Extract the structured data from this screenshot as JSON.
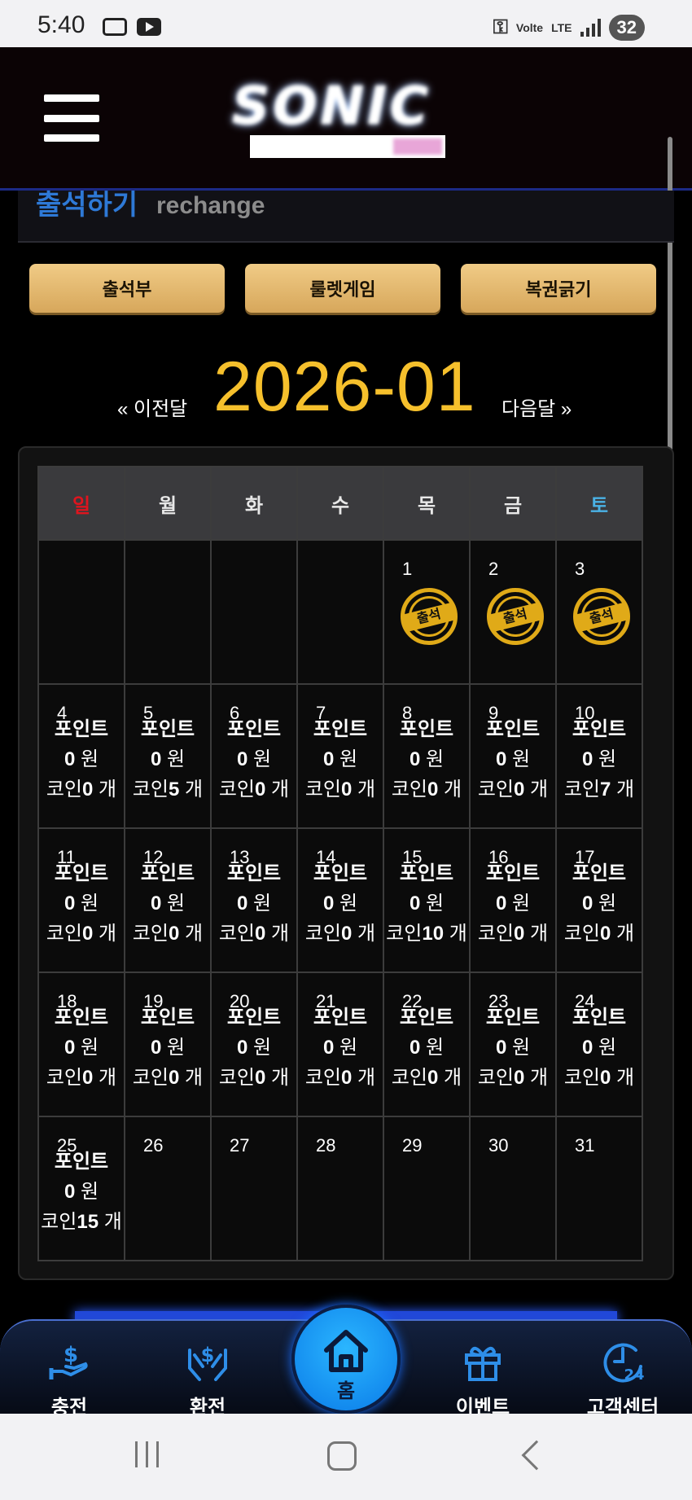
{
  "status_bar": {
    "time": "5:40",
    "network": "Volte",
    "lte": "LTE",
    "battery": "32"
  },
  "header": {
    "logo_text": "SONIC"
  },
  "section": {
    "title": "출석하기",
    "subtitle": "rechange"
  },
  "tabs": [
    "출석부",
    "룰렛게임",
    "복권긁기"
  ],
  "month_nav": {
    "prev": "« 이전달",
    "current": "2026-01",
    "next": "다음달 »"
  },
  "calendar": {
    "weekdays": [
      "일",
      "월",
      "화",
      "수",
      "목",
      "금",
      "토"
    ],
    "stamp_text": "출석",
    "point_label": "포인트",
    "coin_label": "코인",
    "won_unit": "원",
    "count_unit": "개",
    "stamped_days": [
      "1",
      "2",
      "3"
    ],
    "days": {
      "4": {
        "day": "4",
        "point": "0",
        "coin": "0"
      },
      "5": {
        "day": "5",
        "point": "0",
        "coin": "5"
      },
      "6": {
        "day": "6",
        "point": "0",
        "coin": "0"
      },
      "7": {
        "day": "7",
        "point": "0",
        "coin": "0"
      },
      "8": {
        "day": "8",
        "point": "0",
        "coin": "0"
      },
      "9": {
        "day": "9",
        "point": "0",
        "coin": "0"
      },
      "10": {
        "day": "10",
        "point": "0",
        "coin": "7"
      },
      "11": {
        "day": "11",
        "point": "0",
        "coin": "0"
      },
      "12": {
        "day": "12",
        "point": "0",
        "coin": "0"
      },
      "13": {
        "day": "13",
        "point": "0",
        "coin": "0"
      },
      "14": {
        "day": "14",
        "point": "0",
        "coin": "0"
      },
      "15": {
        "day": "15",
        "point": "0",
        "coin": "10"
      },
      "16": {
        "day": "16",
        "point": "0",
        "coin": "0"
      },
      "17": {
        "day": "17",
        "point": "0",
        "coin": "0"
      },
      "18": {
        "day": "18",
        "point": "0",
        "coin": "0"
      },
      "19": {
        "day": "19",
        "point": "0",
        "coin": "0"
      },
      "20": {
        "day": "20",
        "point": "0",
        "coin": "0"
      },
      "21": {
        "day": "21",
        "point": "0",
        "coin": "0"
      },
      "22": {
        "day": "22",
        "point": "0",
        "coin": "0"
      },
      "23": {
        "day": "23",
        "point": "0",
        "coin": "0"
      },
      "24": {
        "day": "24",
        "point": "0",
        "coin": "0"
      },
      "25": {
        "day": "25",
        "point": "0",
        "coin": "15"
      }
    },
    "plain_days": [
      "26",
      "27",
      "28",
      "29",
      "30",
      "31"
    ]
  },
  "bottom_nav": {
    "items": [
      {
        "label": "충전",
        "icon": "charge-hand-dollar-icon"
      },
      {
        "label": "환전",
        "icon": "exchange-hands-dollar-icon"
      },
      {
        "label": "홈",
        "icon": "home-icon"
      },
      {
        "label": "이벤트",
        "icon": "gift-icon"
      },
      {
        "label": "고객센터",
        "icon": "support-24h-icon"
      }
    ]
  },
  "colors": {
    "accent_gold": "#f6c02c",
    "title_blue": "#2e79d6",
    "button_gold": "#e3b86e",
    "nav_blue": "#1a8cf0"
  }
}
